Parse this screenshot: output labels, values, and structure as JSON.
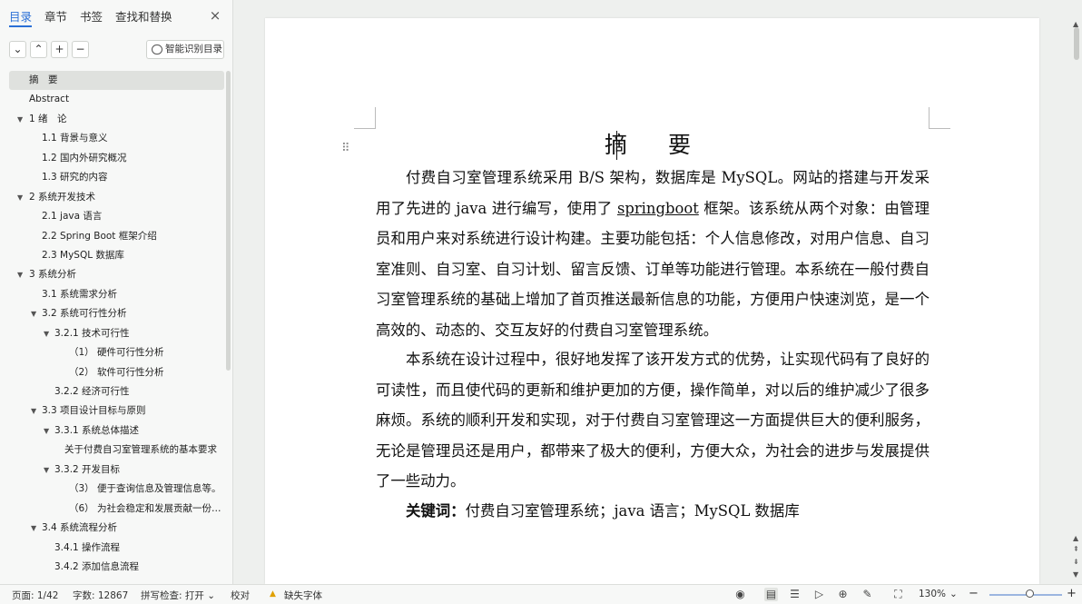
{
  "sidebar": {
    "tabs": [
      "目录",
      "章节",
      "书签",
      "查找和替换"
    ],
    "close_icon": "×",
    "toolbar": {
      "collapse_icon": "⌄",
      "expand_icon": "⌃",
      "add_icon": "+",
      "remove_icon": "−",
      "smart_label": "智能识别目录"
    },
    "toc": [
      {
        "label": "摘　要",
        "level": 0,
        "caret": "",
        "selected": true
      },
      {
        "label": "Abstract",
        "level": 0,
        "caret": ""
      },
      {
        "label": "1 绪　论",
        "level": 0,
        "caret": "▼"
      },
      {
        "label": "1.1 背景与意义",
        "level": 1,
        "caret": ""
      },
      {
        "label": "1.2 国内外研究概况",
        "level": 1,
        "caret": ""
      },
      {
        "label": "1.3 研究的内容",
        "level": 1,
        "caret": ""
      },
      {
        "label": "2 系统开发技术",
        "level": 0,
        "caret": "▼"
      },
      {
        "label": "2.1 java 语言",
        "level": 1,
        "caret": ""
      },
      {
        "label": "2.2 Spring Boot 框架介绍",
        "level": 1,
        "caret": ""
      },
      {
        "label": "2.3 MySQL 数据库",
        "level": 1,
        "caret": ""
      },
      {
        "label": "3 系统分析",
        "level": 0,
        "caret": "▼"
      },
      {
        "label": "3.1 系统需求分析",
        "level": 1,
        "caret": ""
      },
      {
        "label": "3.2 系统可行性分析",
        "level": 1,
        "caret": "▼"
      },
      {
        "label": "3.2.1 技术可行性",
        "level": 2,
        "caret": "▼"
      },
      {
        "label": "（1） 硬件可行性分析",
        "level": 3,
        "caret": ""
      },
      {
        "label": "（2） 软件可行性分析",
        "level": 3,
        "caret": ""
      },
      {
        "label": "3.2.2 经济可行性",
        "level": 2,
        "caret": ""
      },
      {
        "label": "3.3 项目设计目标与原则",
        "level": 1,
        "caret": "▼"
      },
      {
        "label": "3.3.1 系统总体描述",
        "level": 2,
        "caret": "▼"
      },
      {
        "label": "关于付费自习室管理系统的基本要求",
        "level": 3,
        "caret": ""
      },
      {
        "label": "3.3.2 开发目标",
        "level": 2,
        "caret": "▼"
      },
      {
        "label": "（3） 便于查询信息及管理信息等。",
        "level": 3,
        "caret": ""
      },
      {
        "label": "（6） 为社会稳定和发展贡献一份力…",
        "level": 3,
        "caret": ""
      },
      {
        "label": "3.4 系统流程分析",
        "level": 1,
        "caret": "▼"
      },
      {
        "label": "3.4.1 操作流程",
        "level": 2,
        "caret": ""
      },
      {
        "label": "3.4.2 添加信息流程",
        "level": 2,
        "caret": ""
      }
    ]
  },
  "document": {
    "drag_icon": "⠿",
    "title": "摘　要",
    "p1_a": "付费自习室管理系统采用 B/S 架构，数据库是 MySQL。网站的搭建与开发采用了先进的 java 进行编写，使用了 ",
    "p1_u": "springboot",
    "p1_b": " 框架。该系统从两个对象：由管理员和用户来对系统进行设计构建。主要功能包括：个人信息修改，对用户信息、自习室准则、自习室、自习计划、留言反馈、订单等功能进行管理。本系统在一般付费自习室管理系统的基础上增加了首页推送最新信息的功能，方便用户快速浏览，是一个高效的、动态的、交互友好的付费自习室管理系统。",
    "p2": "本系统在设计过程中，很好地发挥了该开发方式的优势，让实现代码有了良好的可读性，而且使代码的更新和维护更加的方便，操作简单，对以后的维护减少了很多麻烦。系统的顺利开发和实现，对于付费自习室管理这一方面提供巨大的便利服务，无论是管理员还是用户，都带来了极大的便利，方便大众，为社会的进步与发展提供了一些动力。",
    "kw_label": "关键词：",
    "kw_text": "付费自习室管理系统；java 语言；MySQL 数据库"
  },
  "statusbar": {
    "page": "页面: 1/42",
    "words": "字数: 12867",
    "spell": "拼写检查: 打开 ⌄",
    "proof": "校对",
    "missing_font_icon": "▲",
    "missing_font": "缺失字体",
    "zoom": "130%",
    "zoom_caret": "⌄",
    "zoom_minus": "−",
    "zoom_plus": "+",
    "zoom_level": 0.55,
    "icons": {
      "eye": "◉",
      "page_view": "▤",
      "outline_view": "☰",
      "play": "▷",
      "web": "⊕",
      "pen": "✎",
      "fit": "⛶"
    }
  },
  "scroll": {
    "up": "▲",
    "prev": "⇞",
    "next": "⇟",
    "down": "▼"
  }
}
